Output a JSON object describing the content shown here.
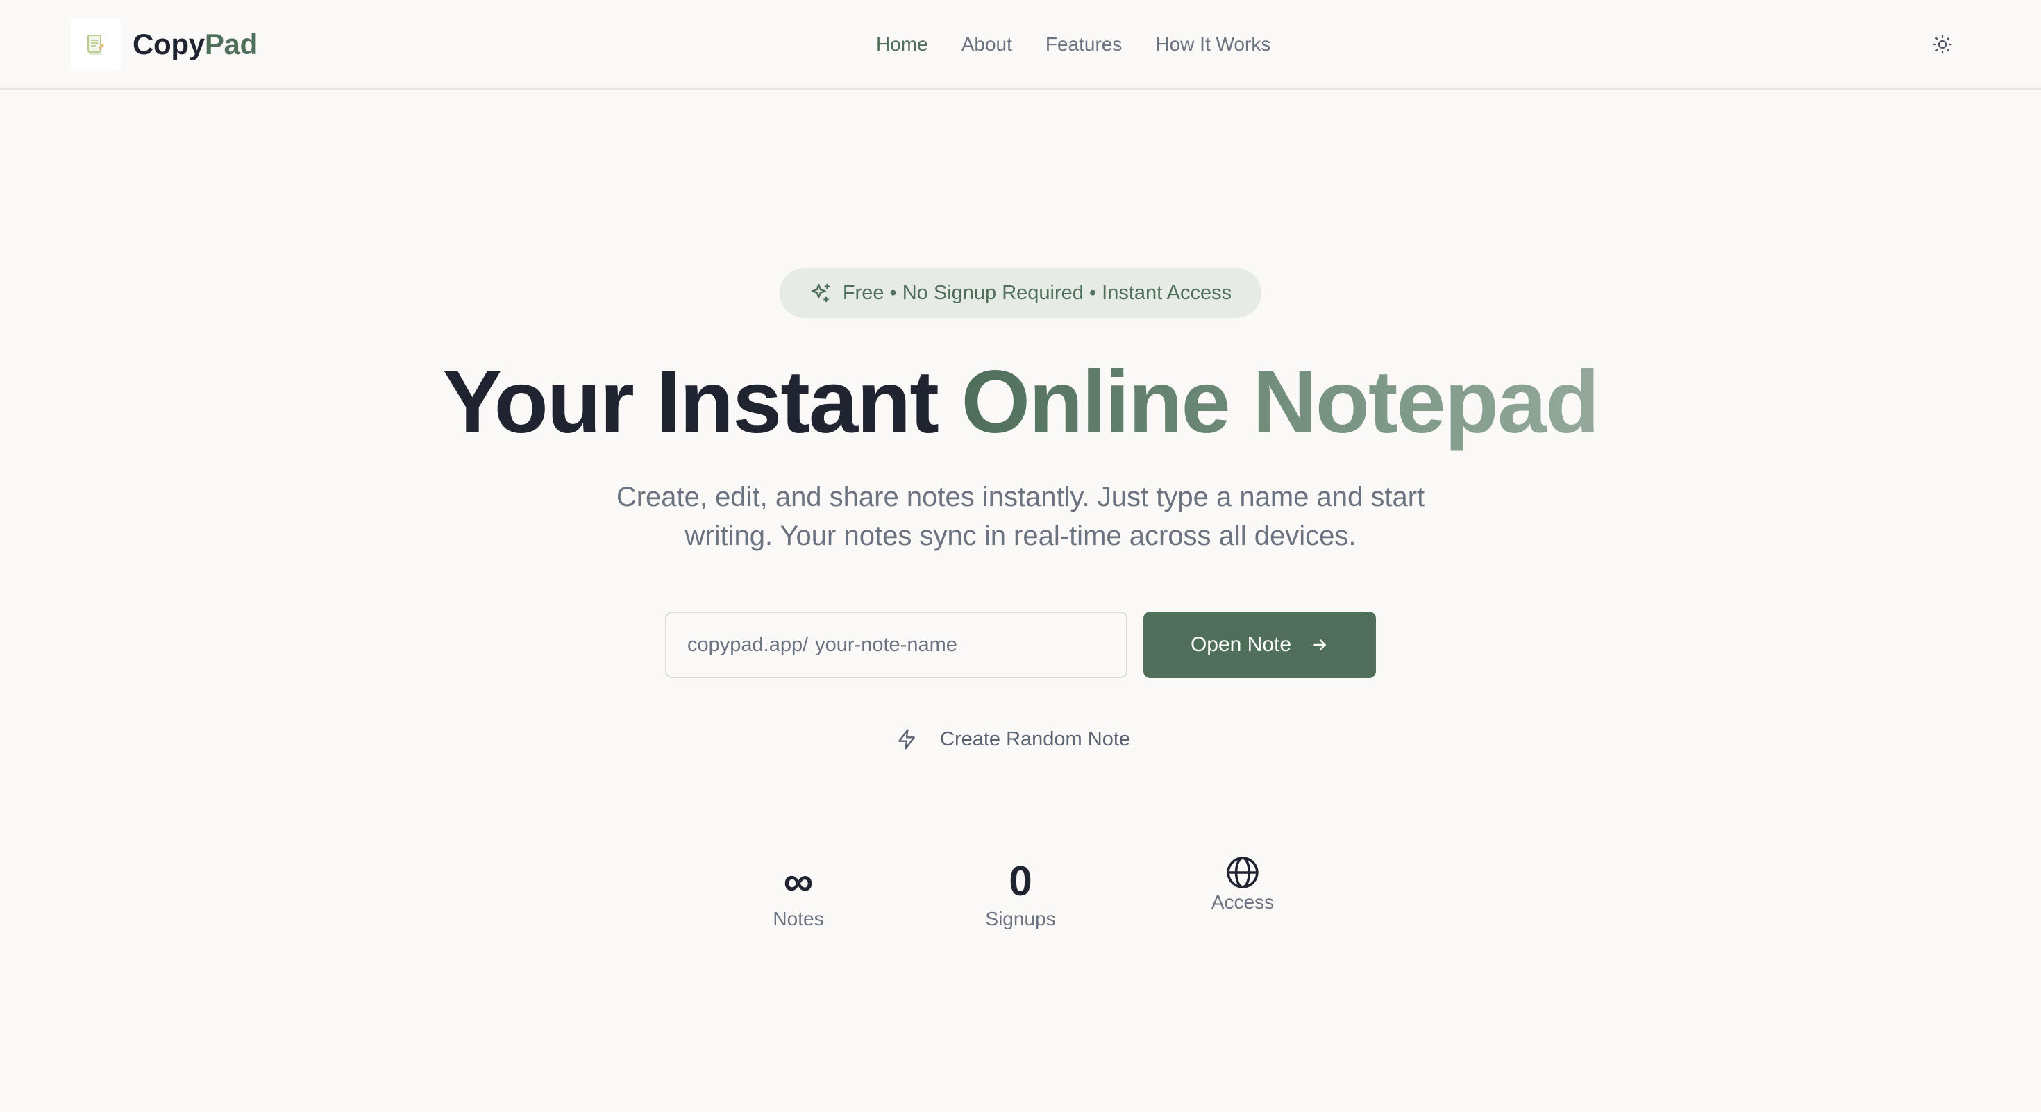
{
  "brand": {
    "name_part1": "Copy",
    "name_part2": "Pad",
    "logo_icon": "notepad-icon"
  },
  "nav": {
    "items": [
      {
        "label": "Home",
        "active": true
      },
      {
        "label": "About",
        "active": false
      },
      {
        "label": "Features",
        "active": false
      },
      {
        "label": "How It Works",
        "active": false
      }
    ],
    "theme_toggle_icon": "sun-icon"
  },
  "hero": {
    "badge_icon": "sparkles-icon",
    "badge_text": "Free • No Signup Required • Instant Access",
    "title_part1": "Your Instant",
    "title_part2": "Online Notepad",
    "subtitle": "Create, edit, and share notes instantly. Just type a name and start writing. Your notes sync in real-time across all devices."
  },
  "note_form": {
    "prefix": "copypad.app/",
    "placeholder": "your-note-name",
    "value": "",
    "submit_label": "Open Note",
    "submit_icon": "arrow-right-icon",
    "random_label": "Create Random Note",
    "random_icon": "lightning-icon"
  },
  "stats": [
    {
      "value": "∞",
      "label": "Notes"
    },
    {
      "value": "0",
      "label": "Signups"
    },
    {
      "icon": "globe-icon",
      "label": "Access"
    }
  ],
  "colors": {
    "accent": "#4f6f5b",
    "background": "#faf9f7",
    "text_dark": "#1f2430",
    "text_muted": "#6b7280",
    "badge_bg": "#e6ebe6"
  }
}
